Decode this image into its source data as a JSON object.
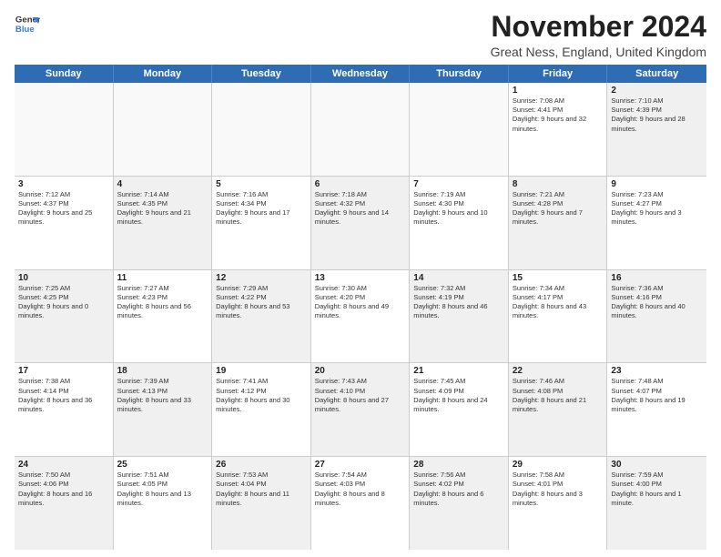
{
  "logo": {
    "line1": "General",
    "line2": "Blue"
  },
  "title": "November 2024",
  "subtitle": "Great Ness, England, United Kingdom",
  "days": [
    "Sunday",
    "Monday",
    "Tuesday",
    "Wednesday",
    "Thursday",
    "Friday",
    "Saturday"
  ],
  "weeks": [
    [
      {
        "day": "",
        "text": "",
        "shaded": true
      },
      {
        "day": "",
        "text": "",
        "shaded": true
      },
      {
        "day": "",
        "text": "",
        "shaded": true
      },
      {
        "day": "",
        "text": "",
        "shaded": true
      },
      {
        "day": "",
        "text": "",
        "shaded": true
      },
      {
        "day": "1",
        "text": "Sunrise: 7:08 AM\nSunset: 4:41 PM\nDaylight: 9 hours and 32 minutes.",
        "shaded": false
      },
      {
        "day": "2",
        "text": "Sunrise: 7:10 AM\nSunset: 4:39 PM\nDaylight: 9 hours and 28 minutes.",
        "shaded": true
      }
    ],
    [
      {
        "day": "3",
        "text": "Sunrise: 7:12 AM\nSunset: 4:37 PM\nDaylight: 9 hours and 25 minutes.",
        "shaded": false
      },
      {
        "day": "4",
        "text": "Sunrise: 7:14 AM\nSunset: 4:35 PM\nDaylight: 9 hours and 21 minutes.",
        "shaded": true
      },
      {
        "day": "5",
        "text": "Sunrise: 7:16 AM\nSunset: 4:34 PM\nDaylight: 9 hours and 17 minutes.",
        "shaded": false
      },
      {
        "day": "6",
        "text": "Sunrise: 7:18 AM\nSunset: 4:32 PM\nDaylight: 9 hours and 14 minutes.",
        "shaded": true
      },
      {
        "day": "7",
        "text": "Sunrise: 7:19 AM\nSunset: 4:30 PM\nDaylight: 9 hours and 10 minutes.",
        "shaded": false
      },
      {
        "day": "8",
        "text": "Sunrise: 7:21 AM\nSunset: 4:28 PM\nDaylight: 9 hours and 7 minutes.",
        "shaded": true
      },
      {
        "day": "9",
        "text": "Sunrise: 7:23 AM\nSunset: 4:27 PM\nDaylight: 9 hours and 3 minutes.",
        "shaded": false
      }
    ],
    [
      {
        "day": "10",
        "text": "Sunrise: 7:25 AM\nSunset: 4:25 PM\nDaylight: 9 hours and 0 minutes.",
        "shaded": true
      },
      {
        "day": "11",
        "text": "Sunrise: 7:27 AM\nSunset: 4:23 PM\nDaylight: 8 hours and 56 minutes.",
        "shaded": false
      },
      {
        "day": "12",
        "text": "Sunrise: 7:29 AM\nSunset: 4:22 PM\nDaylight: 8 hours and 53 minutes.",
        "shaded": true
      },
      {
        "day": "13",
        "text": "Sunrise: 7:30 AM\nSunset: 4:20 PM\nDaylight: 8 hours and 49 minutes.",
        "shaded": false
      },
      {
        "day": "14",
        "text": "Sunrise: 7:32 AM\nSunset: 4:19 PM\nDaylight: 8 hours and 46 minutes.",
        "shaded": true
      },
      {
        "day": "15",
        "text": "Sunrise: 7:34 AM\nSunset: 4:17 PM\nDaylight: 8 hours and 43 minutes.",
        "shaded": false
      },
      {
        "day": "16",
        "text": "Sunrise: 7:36 AM\nSunset: 4:16 PM\nDaylight: 8 hours and 40 minutes.",
        "shaded": true
      }
    ],
    [
      {
        "day": "17",
        "text": "Sunrise: 7:38 AM\nSunset: 4:14 PM\nDaylight: 8 hours and 36 minutes.",
        "shaded": false
      },
      {
        "day": "18",
        "text": "Sunrise: 7:39 AM\nSunset: 4:13 PM\nDaylight: 8 hours and 33 minutes.",
        "shaded": true
      },
      {
        "day": "19",
        "text": "Sunrise: 7:41 AM\nSunset: 4:12 PM\nDaylight: 8 hours and 30 minutes.",
        "shaded": false
      },
      {
        "day": "20",
        "text": "Sunrise: 7:43 AM\nSunset: 4:10 PM\nDaylight: 8 hours and 27 minutes.",
        "shaded": true
      },
      {
        "day": "21",
        "text": "Sunrise: 7:45 AM\nSunset: 4:09 PM\nDaylight: 8 hours and 24 minutes.",
        "shaded": false
      },
      {
        "day": "22",
        "text": "Sunrise: 7:46 AM\nSunset: 4:08 PM\nDaylight: 8 hours and 21 minutes.",
        "shaded": true
      },
      {
        "day": "23",
        "text": "Sunrise: 7:48 AM\nSunset: 4:07 PM\nDaylight: 8 hours and 19 minutes.",
        "shaded": false
      }
    ],
    [
      {
        "day": "24",
        "text": "Sunrise: 7:50 AM\nSunset: 4:06 PM\nDaylight: 8 hours and 16 minutes.",
        "shaded": true
      },
      {
        "day": "25",
        "text": "Sunrise: 7:51 AM\nSunset: 4:05 PM\nDaylight: 8 hours and 13 minutes.",
        "shaded": false
      },
      {
        "day": "26",
        "text": "Sunrise: 7:53 AM\nSunset: 4:04 PM\nDaylight: 8 hours and 11 minutes.",
        "shaded": true
      },
      {
        "day": "27",
        "text": "Sunrise: 7:54 AM\nSunset: 4:03 PM\nDaylight: 8 hours and 8 minutes.",
        "shaded": false
      },
      {
        "day": "28",
        "text": "Sunrise: 7:56 AM\nSunset: 4:02 PM\nDaylight: 8 hours and 6 minutes.",
        "shaded": true
      },
      {
        "day": "29",
        "text": "Sunrise: 7:58 AM\nSunset: 4:01 PM\nDaylight: 8 hours and 3 minutes.",
        "shaded": false
      },
      {
        "day": "30",
        "text": "Sunrise: 7:59 AM\nSunset: 4:00 PM\nDaylight: 8 hours and 1 minute.",
        "shaded": true
      }
    ]
  ]
}
